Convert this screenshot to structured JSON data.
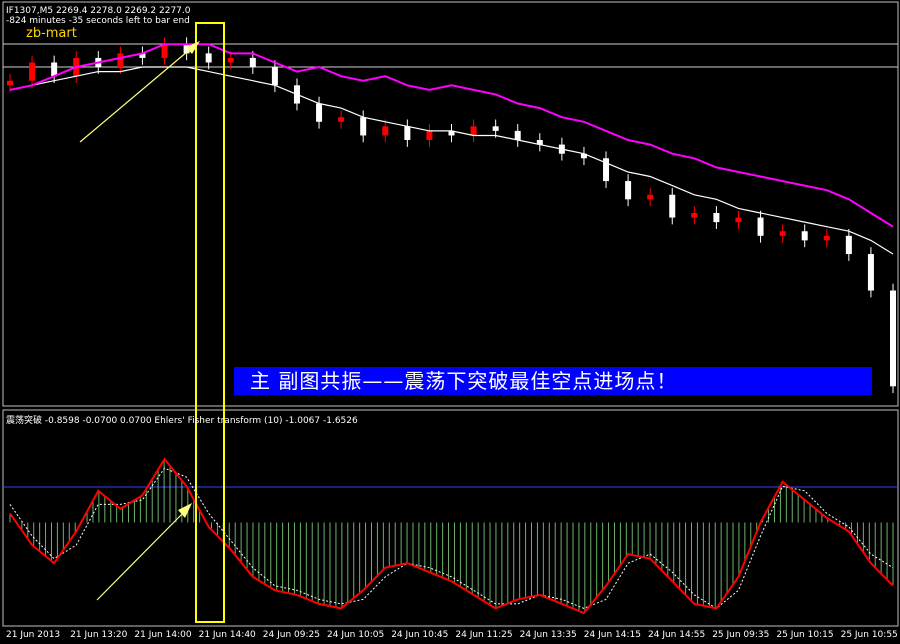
{
  "header": {
    "line1": "IF1307,M5   2269.4 2278.0 2269.2 2277.0",
    "line2": "-824 minutes -35 seconds left to bar end",
    "brand": "zb-mart"
  },
  "banner": {
    "text": "主    副图共振——震荡下突破最佳空点进场点！"
  },
  "indicator": {
    "label": "震荡突破 -0.8598 -0.0700 0.0700  Ehlers' Fisher transform (10) -1.0067 -1.6526"
  },
  "colors": {
    "background": "#000000",
    "bull_candle": "#ff0000",
    "bear_candle": "#ffffff",
    "ma_line": "#ffffff",
    "band_line": "#ff00ff",
    "highlight_box": "#ffff00",
    "banner_bg": "#0000ff",
    "fisher_line": "#ff0000",
    "trigger_line": "#ffffff",
    "histogram": "#90ee90",
    "zero_line": "#0000ff"
  },
  "chart_data": {
    "type": "line",
    "x_ticks": [
      "21 Jun 2013",
      "21 Jun 13:20",
      "21 Jun 14:00",
      "21 Jun 14:40",
      "24 Jun 09:25",
      "24 Jun 10:05",
      "24 Jun 10:45",
      "24 Jun 11:25",
      "24 Jun 13:35",
      "24 Jun 14:15",
      "24 Jun 14:55",
      "25 Jun 09:35",
      "25 Jun 10:15",
      "25 Jun 10:55"
    ],
    "price_closes": [
      2292,
      2296,
      2293,
      2297,
      2295,
      2298,
      2297,
      2300,
      2298,
      2296,
      2297,
      2295,
      2291,
      2287,
      2283,
      2284,
      2280,
      2282,
      2279,
      2281,
      2280,
      2282,
      2281,
      2279,
      2278,
      2276,
      2275,
      2270,
      2266,
      2267,
      2262,
      2263,
      2261,
      2262,
      2258,
      2259,
      2257,
      2258,
      2254,
      2246,
      2225
    ],
    "ma_values": [
      2290,
      2291,
      2292,
      2293,
      2294,
      2294,
      2295,
      2295,
      2295,
      2294,
      2293,
      2292,
      2291,
      2289,
      2287,
      2286,
      2284,
      2283,
      2282,
      2281,
      2281,
      2280,
      2280,
      2279,
      2278,
      2277,
      2276,
      2274,
      2272,
      2271,
      2269,
      2267,
      2266,
      2264,
      2263,
      2262,
      2261,
      2260,
      2259,
      2257,
      2254
    ],
    "band_values": [
      2290,
      2291,
      2293,
      2295,
      2296,
      2297,
      2298,
      2300,
      2300,
      2300,
      2298,
      2298,
      2296,
      2294,
      2295,
      2293,
      2292,
      2293,
      2291,
      2290,
      2291,
      2290,
      2289,
      2287,
      2286,
      2284,
      2283,
      2281,
      2279,
      2278,
      2276,
      2275,
      2273,
      2272,
      2271,
      2270,
      2269,
      2268,
      2266,
      2263,
      2260
    ],
    "fisher_values": [
      0.2,
      -0.5,
      -0.9,
      -0.2,
      0.7,
      0.3,
      0.6,
      1.4,
      0.8,
      -0.1,
      -0.6,
      -1.2,
      -1.5,
      -1.6,
      -1.8,
      -1.9,
      -1.5,
      -1.0,
      -0.9,
      -1.1,
      -1.3,
      -1.6,
      -1.9,
      -1.7,
      -1.6,
      -1.8,
      -2.0,
      -1.4,
      -0.7,
      -0.8,
      -1.3,
      -1.8,
      -1.9,
      -1.2,
      0.0,
      0.9,
      0.5,
      0.1,
      -0.2,
      -0.9,
      -1.4
    ],
    "trigger_values": [
      0.4,
      -0.3,
      -0.8,
      -0.5,
      0.4,
      0.4,
      0.5,
      1.2,
      1.0,
      0.2,
      -0.4,
      -1.0,
      -1.4,
      -1.5,
      -1.7,
      -1.8,
      -1.7,
      -1.2,
      -0.9,
      -1.0,
      -1.2,
      -1.5,
      -1.8,
      -1.8,
      -1.6,
      -1.7,
      -1.9,
      -1.7,
      -0.9,
      -0.7,
      -1.1,
      -1.6,
      -1.9,
      -1.5,
      -0.3,
      0.8,
      0.7,
      0.2,
      -0.1,
      -0.7,
      -1.0
    ],
    "main_ylim": [
      2222,
      2304
    ],
    "sub_ylim": [
      -2.2,
      2.0
    ],
    "zero_level": 0.0,
    "grid": false
  }
}
